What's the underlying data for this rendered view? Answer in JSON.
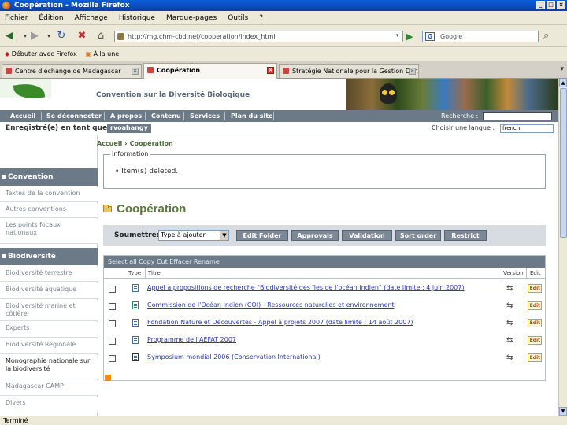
{
  "window": {
    "title": "Coopération - Mozilla Firefox"
  },
  "menu": [
    "Fichier",
    "Édition",
    "Affichage",
    "Historique",
    "Marque-pages",
    "Outils",
    "?"
  ],
  "nav": {
    "url": "http://mg.chm-cbd.net/cooperation/index_html",
    "search_placeholder": "Google"
  },
  "bookmarks": [
    "Débuter avec Firefox",
    "À la une"
  ],
  "tabs": [
    {
      "label": "Centre d'échange de Madagascar"
    },
    {
      "label": "Coopération"
    },
    {
      "label": "Stratégie Nationale pour la Gestion Dur..."
    }
  ],
  "site": {
    "banner_title": "Convention sur la Diversité Biologique",
    "nav_links": [
      "Accueil",
      "Se déconnecter",
      "A propos",
      "Contenu",
      "Services",
      "Plan du site"
    ],
    "search_label": "Recherche :",
    "registered_label": "Enregistré(e) en tant que :",
    "username": "rvoahangy",
    "lang_label": "Choisir une langue :",
    "lang_value": "french"
  },
  "sidebar": {
    "section1": "Convention",
    "section1_items": [
      "Textes de la convention",
      "Autres conventions",
      "Les points focaux nationaux"
    ],
    "section2": "Biodiversité",
    "section2_items": [
      "Biodiversité terrestre",
      "Biodiversité aquatique",
      "Biodiversité marine et côtière",
      "Experts",
      "Biodiversité Régionale",
      "Monographie nationale sur la biodiversité",
      "Madagascar CAMP",
      "Divers"
    ]
  },
  "breadcrumb": {
    "home": "Accueil",
    "current": "Coopération"
  },
  "info": {
    "legend": "Information",
    "message": "• Item(s) deleted."
  },
  "main": {
    "title": "Coopération",
    "submit_label": "Soumettre:",
    "type_select": "Type à ajouter",
    "buttons": [
      "Edit Folder",
      "Approvals",
      "Validation",
      "Sort order",
      "Restrict"
    ],
    "list_actions": "Select all  Copy  Cut  Effacer  Rename",
    "columns": {
      "type": "Type",
      "title": "Titre",
      "version": "Version",
      "edit": "Edit"
    },
    "edit_label": "Edit",
    "rows": [
      "Appel à propositions de recherche \"Biodiversité des îles de l'océan Indien\" (date limite : 4 juin 2007)",
      "Commission de l'Océan Indien (COI) - Ressources naturelles et environnement",
      "Fondation Nature et Découvertes - Appel à projets 2007 (date limite : 14 août 2007)",
      "Programme de l'AEFAT 2007",
      "Symposium mondial 2006 (Conservation International)"
    ]
  },
  "status": "Terminé"
}
